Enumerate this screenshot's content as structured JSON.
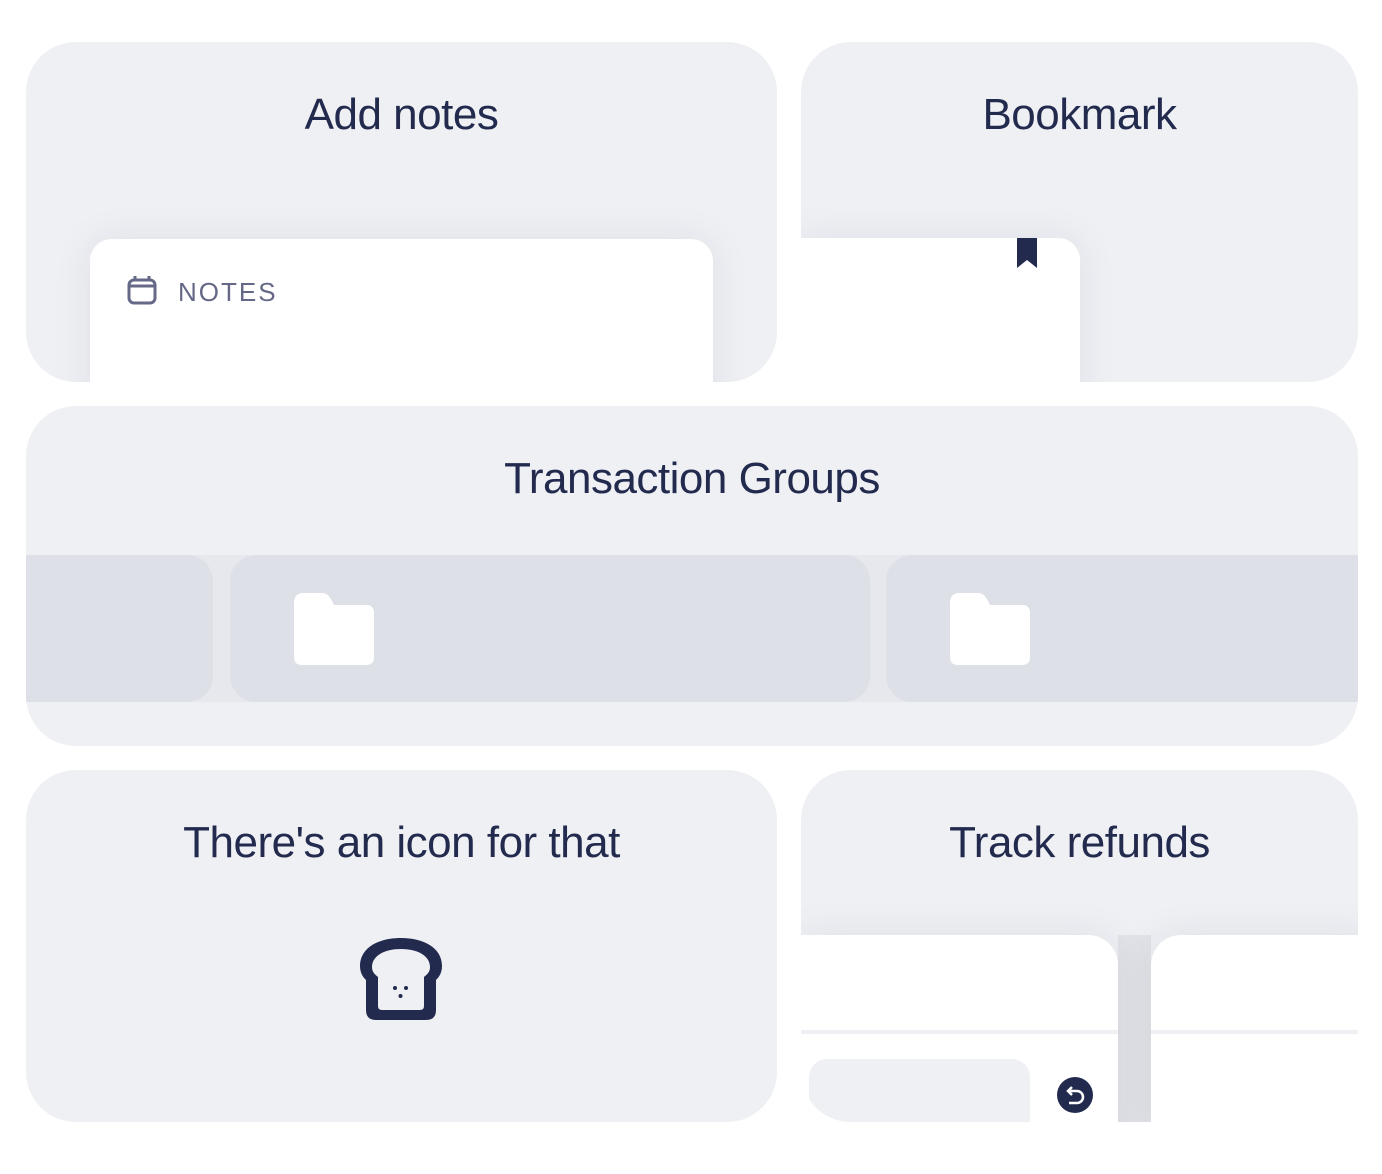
{
  "cards": {
    "notes": {
      "title": "Add notes",
      "label": "NOTES",
      "icon": "calendar-icon"
    },
    "bookmark": {
      "title": "Bookmark",
      "icon": "bookmark-icon"
    },
    "groups": {
      "title": "Transaction Groups",
      "icon": "folder-icon"
    },
    "icons": {
      "title": "There's an icon for that",
      "icon": "toast-icon"
    },
    "refunds": {
      "title": "Track refunds",
      "icon": "refund-icon"
    }
  },
  "colors": {
    "text": "#222a4e",
    "card": "#eff0f4",
    "label": "#656887"
  }
}
